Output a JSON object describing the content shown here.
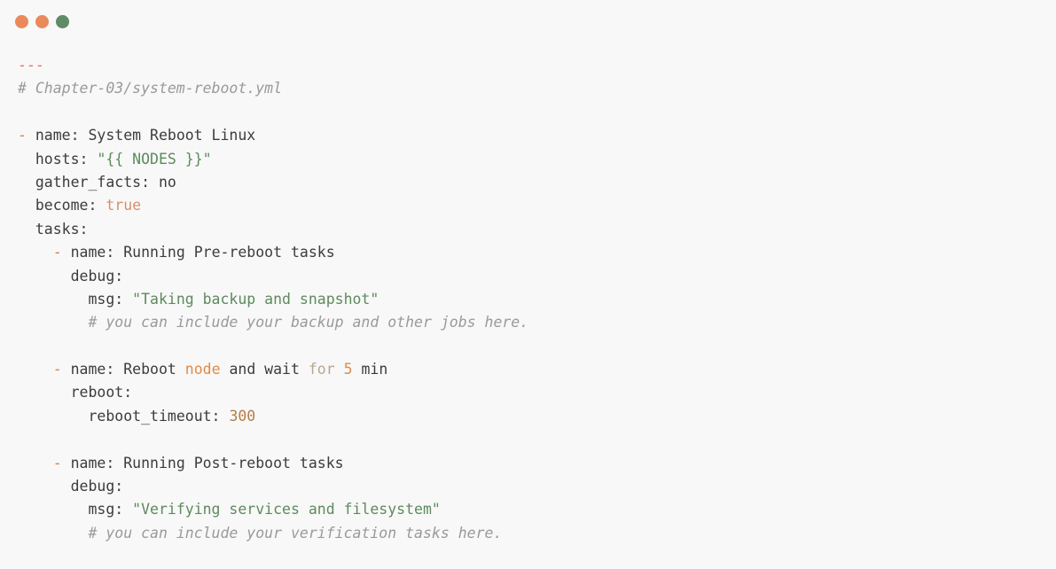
{
  "window": {
    "controls": [
      {
        "name": "close",
        "color": "#e98a5a"
      },
      {
        "name": "minimize",
        "color": "#e98a5a"
      },
      {
        "name": "zoom",
        "color": "#5f8b66"
      }
    ]
  },
  "colors": {
    "background": "#f8f8f8",
    "text": "#3c3c3c",
    "comment": "#9a9a9a",
    "dash": "#e07a4a",
    "string": "#5d8a5d",
    "boolean": "#d9906a",
    "number": "#b57d48"
  },
  "code": {
    "lines": [
      {
        "indent": "",
        "tokens": [
          {
            "t": "---",
            "c": "sep"
          }
        ]
      },
      {
        "indent": "",
        "tokens": [
          {
            "t": "# Chapter-03/system-reboot.yml",
            "c": "comment"
          }
        ]
      },
      {
        "indent": "",
        "tokens": []
      },
      {
        "indent": "",
        "tokens": [
          {
            "t": "- ",
            "c": "dash"
          },
          {
            "t": "name: System Reboot Linux",
            "c": "plain"
          }
        ]
      },
      {
        "indent": "  ",
        "tokens": [
          {
            "t": "hosts: ",
            "c": "plain"
          },
          {
            "t": "\"{{ NODES }}\"",
            "c": "str"
          }
        ]
      },
      {
        "indent": "  ",
        "tokens": [
          {
            "t": "gather_facts: no",
            "c": "plain"
          }
        ]
      },
      {
        "indent": "  ",
        "tokens": [
          {
            "t": "become: ",
            "c": "plain"
          },
          {
            "t": "true",
            "c": "bool"
          }
        ]
      },
      {
        "indent": "  ",
        "tokens": [
          {
            "t": "tasks:",
            "c": "plain"
          }
        ]
      },
      {
        "indent": "    ",
        "tokens": [
          {
            "t": "- ",
            "c": "dash"
          },
          {
            "t": "name: Running Pre-reboot tasks",
            "c": "plain"
          }
        ]
      },
      {
        "indent": "      ",
        "tokens": [
          {
            "t": "debug:",
            "c": "plain"
          }
        ]
      },
      {
        "indent": "        ",
        "tokens": [
          {
            "t": "msg: ",
            "c": "plain"
          },
          {
            "t": "\"Taking backup and snapshot\"",
            "c": "str"
          }
        ]
      },
      {
        "indent": "        ",
        "tokens": [
          {
            "t": "# you can include your backup and other jobs here.",
            "c": "comment"
          }
        ]
      },
      {
        "indent": "",
        "tokens": []
      },
      {
        "indent": "    ",
        "tokens": [
          {
            "t": "- ",
            "c": "dash"
          },
          {
            "t": "name: Reboot ",
            "c": "plain"
          },
          {
            "t": "node",
            "c": "kwhl"
          },
          {
            "t": " and wait ",
            "c": "plain"
          },
          {
            "t": "for",
            "c": "kwdim"
          },
          {
            "t": " ",
            "c": "plain"
          },
          {
            "t": "5",
            "c": "kwhl"
          },
          {
            "t": " min",
            "c": "plain"
          }
        ]
      },
      {
        "indent": "      ",
        "tokens": [
          {
            "t": "reboot:",
            "c": "plain"
          }
        ]
      },
      {
        "indent": "        ",
        "tokens": [
          {
            "t": "reboot_timeout: ",
            "c": "plain"
          },
          {
            "t": "300",
            "c": "num"
          }
        ]
      },
      {
        "indent": "",
        "tokens": []
      },
      {
        "indent": "    ",
        "tokens": [
          {
            "t": "- ",
            "c": "dash"
          },
          {
            "t": "name: Running Post-reboot tasks",
            "c": "plain"
          }
        ]
      },
      {
        "indent": "      ",
        "tokens": [
          {
            "t": "debug:",
            "c": "plain"
          }
        ]
      },
      {
        "indent": "        ",
        "tokens": [
          {
            "t": "msg: ",
            "c": "plain"
          },
          {
            "t": "\"Verifying services and filesystem\"",
            "c": "str"
          }
        ]
      },
      {
        "indent": "        ",
        "tokens": [
          {
            "t": "# you can include your verification tasks here.",
            "c": "comment"
          }
        ]
      }
    ]
  }
}
